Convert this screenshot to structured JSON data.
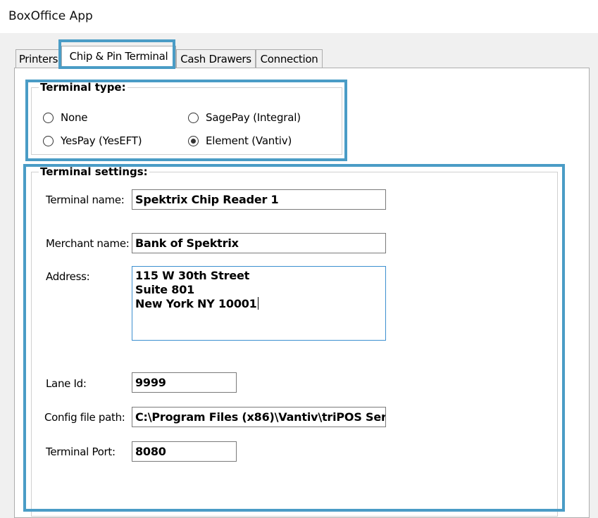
{
  "window": {
    "title": "BoxOffice App"
  },
  "tabs": [
    {
      "label": "Printers",
      "selected": false
    },
    {
      "label": "Chip & Pin Terminal",
      "selected": true
    },
    {
      "label": "Cash Drawers",
      "selected": false
    },
    {
      "label": "Connection",
      "selected": false
    }
  ],
  "terminal_type": {
    "legend": "Terminal type:",
    "options": [
      {
        "label": "None",
        "checked": false
      },
      {
        "label": "SagePay (Integral)",
        "checked": false
      },
      {
        "label": "YesPay (YesEFT)",
        "checked": false
      },
      {
        "label": "Element (Vantiv)",
        "checked": true
      }
    ]
  },
  "terminal_settings": {
    "legend": "Terminal settings:",
    "terminal_name": {
      "label": "Terminal name:",
      "value": "Spektrix Chip Reader 1"
    },
    "merchant_name": {
      "label": "Merchant name:",
      "value": "Bank of Spektrix"
    },
    "address": {
      "label": "Address:",
      "lines": [
        "115 W 30th Street",
        "Suite 801",
        "New York NY 10001"
      ]
    },
    "lane_id": {
      "label": "Lane Id:",
      "value": "9999"
    },
    "config_file_path": {
      "label": "Config file path:",
      "value": "C:\\Program Files (x86)\\Vantiv\\triPOS Ser"
    },
    "terminal_port": {
      "label": "Terminal Port:",
      "value": "8080"
    }
  },
  "colors": {
    "highlight": "#4a9cc6",
    "focus_border": "#3c8fd0"
  }
}
